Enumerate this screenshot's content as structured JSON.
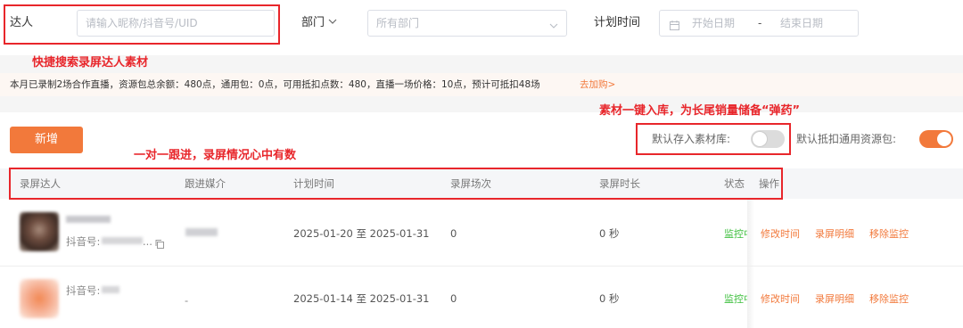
{
  "filters": {
    "talent": {
      "label": "达人",
      "placeholder": "请输入昵称/抖音号/UID"
    },
    "department": {
      "label": "部门",
      "placeholder": "所有部门"
    },
    "plan_time": {
      "label": "计划时间",
      "start_placeholder": "开始日期",
      "separator": "-",
      "end_placeholder": "结束日期"
    }
  },
  "annotations": {
    "search": "快捷搜索录屏达人素材",
    "library": "素材一键入库，为长尾销量储备“弹药”",
    "followup": "一对一跟进，录屏情况心中有数"
  },
  "info_bar": {
    "text": "本月已录制2场合作直播，资源包总余额：480点，通用包：0点，可用抵扣点数：480，直播一场价格：10点，预计可抵扣48场",
    "link": "去加购>"
  },
  "toolbar": {
    "add_label": "新增",
    "store_label": "默认存入素材库:",
    "store_on": false,
    "deduct_label": "默认抵扣通用资源包:",
    "deduct_on": true
  },
  "table": {
    "headers": [
      "录屏达人",
      "跟进媒介",
      "计划时间",
      "录屏场次",
      "录屏时长",
      "状态",
      "操作"
    ],
    "rows": [
      {
        "douyin_prefix": "抖音号:",
        "media": "",
        "plan_time": "2025-01-20 至 2025-01-31",
        "sessions": "0",
        "duration": "0 秒",
        "status": "监控中",
        "actions": [
          "修改时间",
          "录屏明细",
          "移除监控"
        ]
      },
      {
        "douyin_prefix": "抖音号:",
        "media": "-",
        "plan_time": "2025-01-14 至 2025-01-31",
        "sessions": "0",
        "duration": "0 秒",
        "status": "监控中",
        "actions": [
          "修改时间",
          "录屏明细",
          "移除监控"
        ]
      }
    ]
  },
  "colors": {
    "accent": "#f2793b",
    "annotation_red": "#e8262b",
    "status_green": "#3cbf3c",
    "info_bg": "#fdf7f3"
  }
}
